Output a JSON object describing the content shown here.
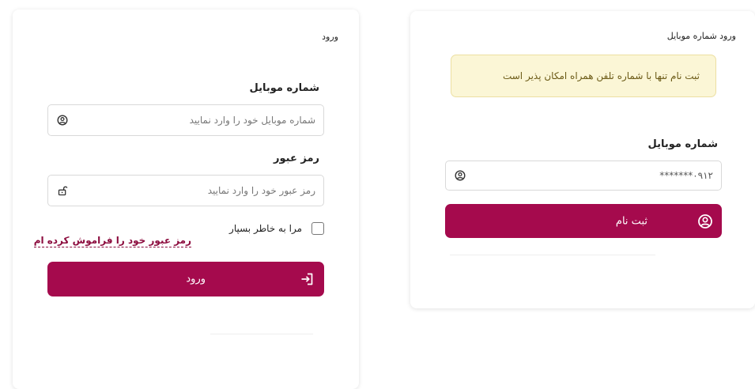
{
  "login": {
    "title": "ورود",
    "mobile_label": "شماره موبایل",
    "mobile_placeholder": "شماره موبایل خود را وارد نمایید",
    "mobile_icon": "user-circle-icon",
    "password_label": "رمز عبور",
    "password_placeholder": "رمز عبور خود را وارد نمایید",
    "password_icon": "unlock-icon",
    "remember_label": "مرا به خاطر بسپار",
    "remember_checked": false,
    "forgot_link": "رمز عبور خود را فراموش کرده ام",
    "submit_label": "ورود",
    "submit_icon": "login-arrow-icon"
  },
  "signup": {
    "title": "ورود شماره موبایل",
    "notice": "ثبت نام تنها با شماره تلفن همراه امکان پذیر است",
    "mobile_label": "شماره موبایل",
    "mobile_value": "۰۹۱۲*******",
    "mobile_icon": "user-circle-icon",
    "submit_label": "ثبت نام",
    "submit_icon": "user-circle-icon"
  },
  "colors": {
    "brand": "#a50a4d",
    "link": "#8c0c3e",
    "notice_bg": "#fbf6d6",
    "notice_border": "#ecdfa2"
  }
}
